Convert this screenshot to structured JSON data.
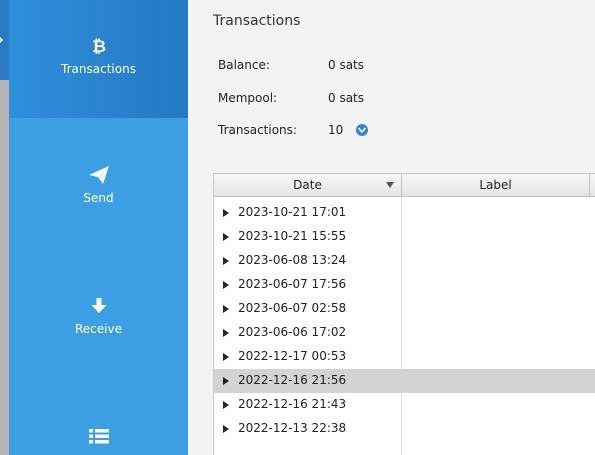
{
  "sidebar": {
    "items": [
      {
        "label": "Transactions",
        "icon": "bitcoin-icon",
        "active": true
      },
      {
        "label": "Send",
        "icon": "paper-plane-icon",
        "active": false
      },
      {
        "label": "Receive",
        "icon": "arrow-down-icon",
        "active": false
      },
      {
        "label": "",
        "icon": "list-icon",
        "active": false
      }
    ]
  },
  "main": {
    "title": "Transactions",
    "summary": [
      {
        "label": "Balance:",
        "value": "0 sats"
      },
      {
        "label": "Mempool:",
        "value": "0 sats"
      },
      {
        "label": "Transactions:",
        "value": "10"
      }
    ],
    "table": {
      "columns": [
        "Date",
        "Label"
      ],
      "rows": [
        {
          "date": "2023-10-21 17:01",
          "label": ""
        },
        {
          "date": "2023-10-21 15:55",
          "label": ""
        },
        {
          "date": "2023-06-08 13:24",
          "label": ""
        },
        {
          "date": "2023-06-07 17:56",
          "label": ""
        },
        {
          "date": "2023-06-07 02:58",
          "label": ""
        },
        {
          "date": "2023-06-06 17:02",
          "label": ""
        },
        {
          "date": "2022-12-17 00:53",
          "label": ""
        },
        {
          "date": "2022-12-16 21:56",
          "label": "",
          "selected": true
        },
        {
          "date": "2022-12-16 21:43",
          "label": ""
        },
        {
          "date": "2022-12-13 22:38",
          "label": ""
        }
      ]
    }
  },
  "colors": {
    "sidebar": "#3d9fe3",
    "sidebar_active": "#2479c3",
    "selected_row": "#d3d3d3",
    "accent": "#2f86cf"
  }
}
